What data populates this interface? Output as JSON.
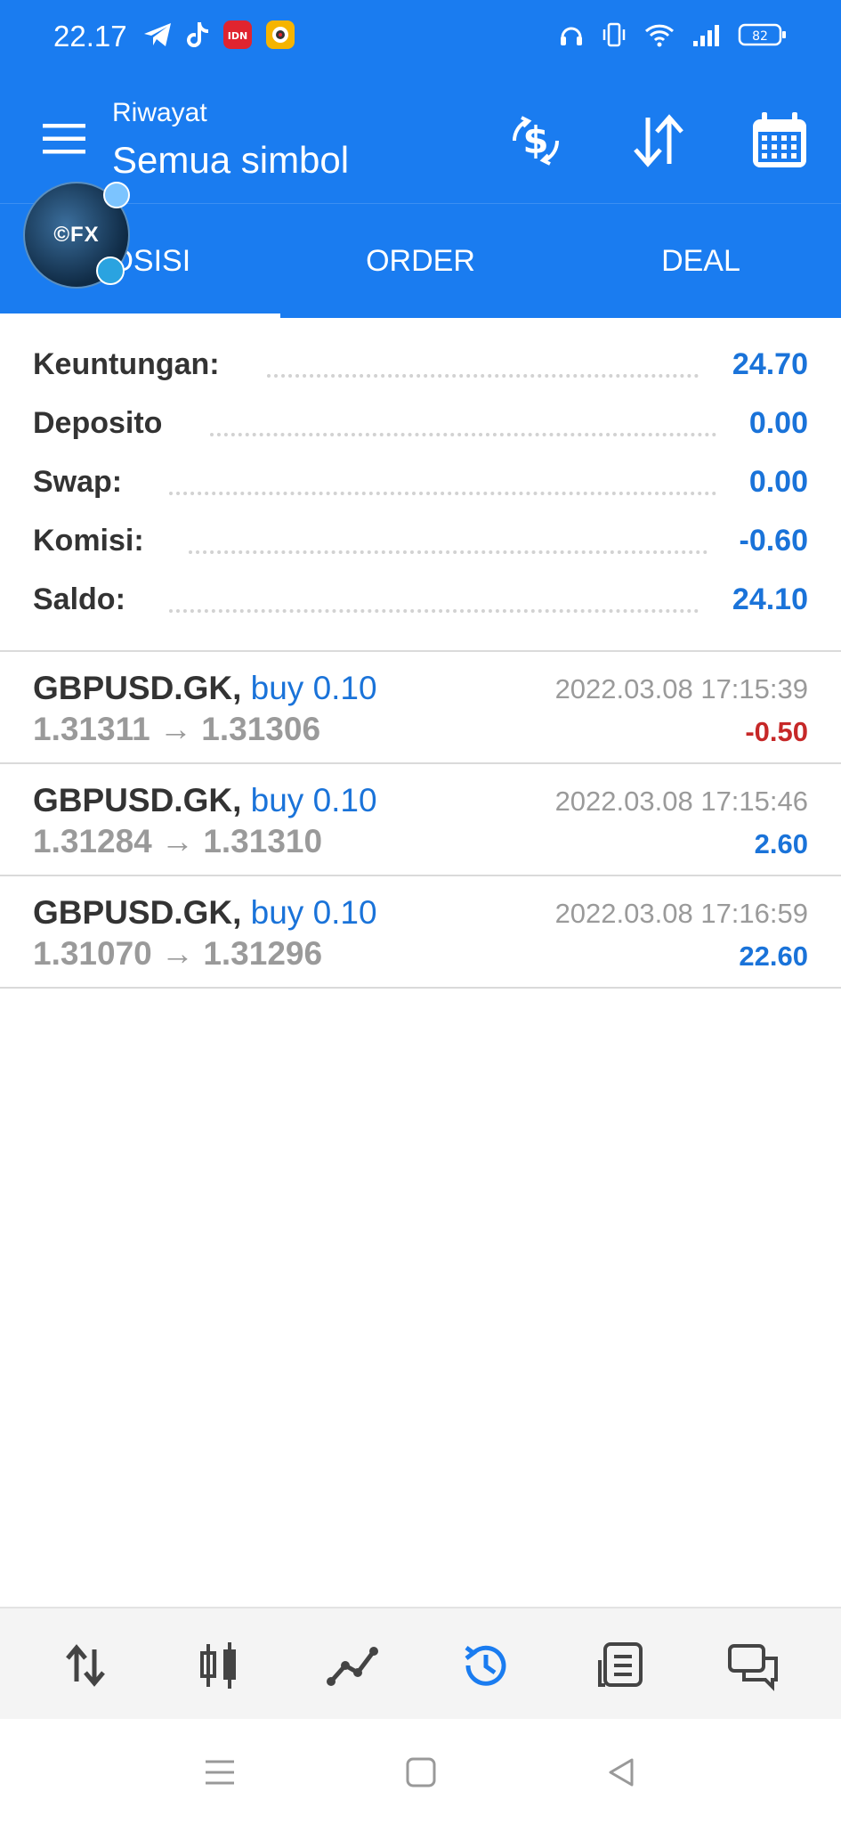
{
  "status_bar": {
    "time": "22.17",
    "battery": "82",
    "left_icons": [
      "telegram-icon",
      "tiktok-icon",
      "idn-app-icon",
      "camera-app-icon"
    ],
    "right_icons": [
      "headset-icon",
      "vibrate-icon",
      "wifi-icon",
      "signal-icon",
      "battery-icon"
    ]
  },
  "app_bar": {
    "subtitle": "Riwayat",
    "title": "Semua simbol",
    "actions": [
      "currency-exchange-icon",
      "sort-icon",
      "calendar-icon"
    ]
  },
  "avatar": {
    "text": "©FX"
  },
  "tabs": [
    {
      "label": "POSISI",
      "active": true
    },
    {
      "label": "ORDER",
      "active": false
    },
    {
      "label": "DEAL",
      "active": false
    }
  ],
  "summary": [
    {
      "label": "Keuntungan:",
      "value": "24.70"
    },
    {
      "label": "Deposito",
      "value": "0.00"
    },
    {
      "label": "Swap:",
      "value": "0.00"
    },
    {
      "label": "Komisi:",
      "value": "-0.60"
    },
    {
      "label": "Saldo:",
      "value": "24.10"
    }
  ],
  "deals": [
    {
      "symbol": "GBPUSD.GK,",
      "side": "buy 0.10",
      "open": "1.31311",
      "arrow": "→",
      "close": "1.31306",
      "time": "2022.03.08 17:15:39",
      "profit": "-0.50",
      "negative": true
    },
    {
      "symbol": "GBPUSD.GK,",
      "side": "buy 0.10",
      "open": "1.31284",
      "arrow": "→",
      "close": "1.31310",
      "time": "2022.03.08 17:15:46",
      "profit": "2.60",
      "negative": false
    },
    {
      "symbol": "GBPUSD.GK,",
      "side": "buy 0.10",
      "open": "1.31070",
      "arrow": "→",
      "close": "1.31296",
      "time": "2022.03.08 17:16:59",
      "profit": "22.60",
      "negative": false
    }
  ],
  "bottom_nav": [
    "quotes-icon",
    "chart-icon",
    "trade-icon",
    "history-icon",
    "news-icon",
    "messages-icon"
  ],
  "bottom_nav_active": "history-icon",
  "colors": {
    "primary": "#1a7cf0",
    "value_blue": "#1a73d9",
    "negative_red": "#c62828",
    "muted_gray": "#9a9a9a"
  }
}
